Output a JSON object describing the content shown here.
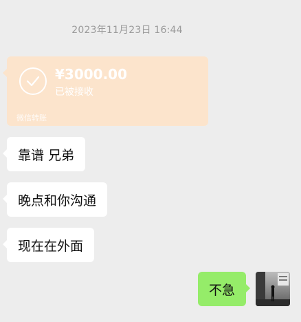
{
  "chat": {
    "timestamp": "2023年11月23日 16:44",
    "transfer": {
      "amount": "¥3000.00",
      "status": "已被接收",
      "footer": "微信转账",
      "card_color": "#FCE4CC"
    },
    "messages_received": [
      {
        "text": "靠谱 兄弟"
      },
      {
        "text": "晚点和你沟通"
      },
      {
        "text": "现在在外面"
      }
    ],
    "messages_sent": [
      {
        "text": "不急"
      }
    ],
    "colors": {
      "background": "#EDEDED",
      "sent_bubble": "#95EC69",
      "received_bubble": "#FFFFFF"
    }
  }
}
